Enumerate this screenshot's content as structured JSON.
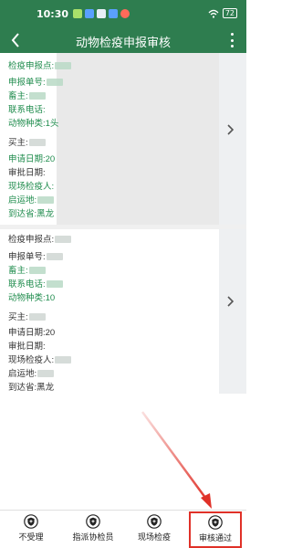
{
  "status_bar": {
    "time": "10:30",
    "battery": "72"
  },
  "header": {
    "title": "动物检疫申报审核",
    "back_icon": "back-arrow-icon",
    "more_icon": "more-vertical-icon"
  },
  "records": [
    {
      "declare_point": "检疫申报点:",
      "order_no": "申报单号:",
      "owner": "畜主:",
      "phone": "联系电话:",
      "species": "动物种类:1头",
      "buyer": "买主:",
      "apply_date": "申请日期:20",
      "approve_date": "审批日期:",
      "inspector": "现场检疫人:",
      "origin": "启运地:",
      "destination": "到达省:黑龙"
    },
    {
      "declare_point": "检疫申报点:",
      "order_no": "申报单号:",
      "owner": "畜主:",
      "phone": "联系电话:",
      "species": "动物种类:10",
      "buyer": "买主:",
      "apply_date": "申请日期:20",
      "approve_date": "审批日期:",
      "inspector": "现场检疫人:",
      "origin": "启运地:",
      "destination": "到达省:黑龙"
    }
  ],
  "bottom_nav": [
    {
      "label": "不受理",
      "icon": "shield-icon"
    },
    {
      "label": "指派协检员",
      "icon": "shield-icon"
    },
    {
      "label": "现场检疫",
      "icon": "shield-icon"
    },
    {
      "label": "审核通过",
      "icon": "shield-icon"
    }
  ],
  "colors": {
    "primary": "#2e7d4f",
    "label_green": "#1f8c4d",
    "highlight_red": "#e03128"
  }
}
